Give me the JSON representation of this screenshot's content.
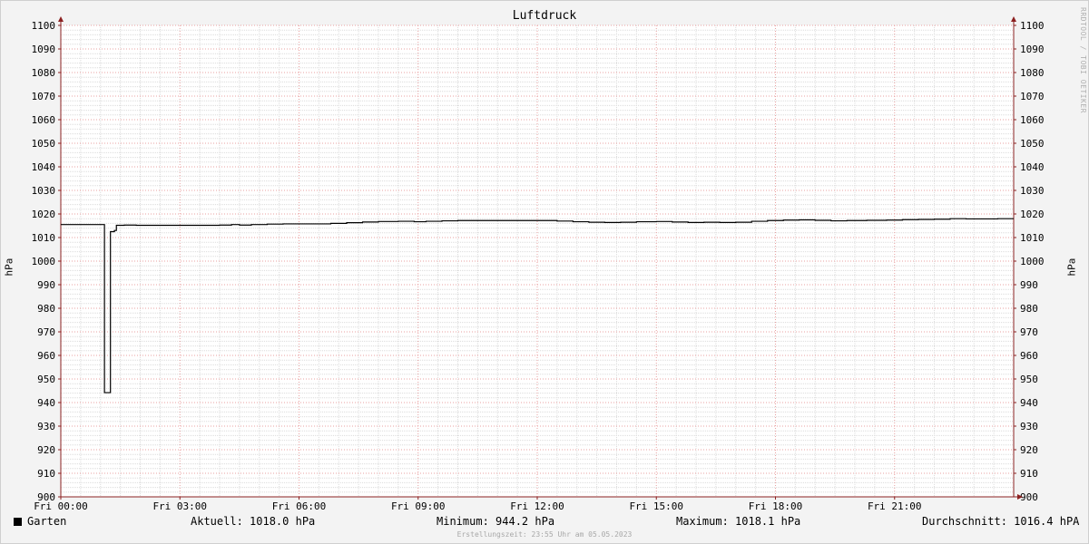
{
  "chart_data": {
    "type": "line",
    "title": "Luftdruck",
    "ylabel": "hPa",
    "ylim": [
      900,
      1100
    ],
    "yticks": [
      900,
      910,
      920,
      930,
      940,
      950,
      960,
      970,
      980,
      990,
      1000,
      1010,
      1020,
      1030,
      1040,
      1050,
      1060,
      1070,
      1080,
      1090,
      1100
    ],
    "xlim_hours": [
      0,
      24
    ],
    "xticks": [
      {
        "hour": 0,
        "label": "Fri 00:00"
      },
      {
        "hour": 3,
        "label": "Fri 03:00"
      },
      {
        "hour": 6,
        "label": "Fri 06:00"
      },
      {
        "hour": 9,
        "label": "Fri 09:00"
      },
      {
        "hour": 12,
        "label": "Fri 12:00"
      },
      {
        "hour": 15,
        "label": "Fri 15:00"
      },
      {
        "hour": 18,
        "label": "Fri 18:00"
      },
      {
        "hour": 21,
        "label": "Fri 21:00"
      }
    ],
    "grid": true,
    "series": [
      {
        "name": "Garten",
        "color": "#000000",
        "points": [
          [
            0.0,
            1015.5
          ],
          [
            1.05,
            1015.5
          ],
          [
            1.1,
            944.2
          ],
          [
            1.18,
            944.2
          ],
          [
            1.25,
            1012.5
          ],
          [
            1.35,
            1013.0
          ],
          [
            1.4,
            1015.2
          ],
          [
            1.6,
            1015.3
          ],
          [
            1.9,
            1015.2
          ],
          [
            2.2,
            1015.2
          ],
          [
            2.5,
            1015.2
          ],
          [
            3.0,
            1015.2
          ],
          [
            3.5,
            1015.2
          ],
          [
            4.0,
            1015.3
          ],
          [
            4.3,
            1015.5
          ],
          [
            4.5,
            1015.3
          ],
          [
            4.8,
            1015.5
          ],
          [
            5.2,
            1015.7
          ],
          [
            5.6,
            1015.8
          ],
          [
            6.0,
            1015.8
          ],
          [
            6.5,
            1015.8
          ],
          [
            6.8,
            1016.0
          ],
          [
            7.2,
            1016.3
          ],
          [
            7.6,
            1016.6
          ],
          [
            8.0,
            1016.8
          ],
          [
            8.5,
            1016.9
          ],
          [
            8.9,
            1016.7
          ],
          [
            9.2,
            1016.9
          ],
          [
            9.6,
            1017.1
          ],
          [
            10.0,
            1017.2
          ],
          [
            10.5,
            1017.2
          ],
          [
            11.0,
            1017.2
          ],
          [
            11.5,
            1017.2
          ],
          [
            12.0,
            1017.2
          ],
          [
            12.5,
            1017.0
          ],
          [
            12.9,
            1016.7
          ],
          [
            13.3,
            1016.5
          ],
          [
            13.7,
            1016.4
          ],
          [
            14.1,
            1016.5
          ],
          [
            14.5,
            1016.7
          ],
          [
            15.0,
            1016.8
          ],
          [
            15.4,
            1016.6
          ],
          [
            15.8,
            1016.4
          ],
          [
            16.2,
            1016.5
          ],
          [
            16.6,
            1016.4
          ],
          [
            17.0,
            1016.5
          ],
          [
            17.4,
            1016.9
          ],
          [
            17.8,
            1017.2
          ],
          [
            18.2,
            1017.4
          ],
          [
            18.6,
            1017.5
          ],
          [
            19.0,
            1017.3
          ],
          [
            19.4,
            1017.1
          ],
          [
            19.8,
            1017.2
          ],
          [
            20.3,
            1017.3
          ],
          [
            20.8,
            1017.4
          ],
          [
            21.2,
            1017.6
          ],
          [
            21.6,
            1017.7
          ],
          [
            22.0,
            1017.8
          ],
          [
            22.4,
            1018.0
          ],
          [
            22.8,
            1017.9
          ],
          [
            23.2,
            1017.9
          ],
          [
            23.6,
            1018.0
          ],
          [
            24.0,
            1018.0
          ]
        ]
      }
    ]
  },
  "watermark": "RRDTOOL / TOBI OETIKER",
  "legend": {
    "series_name": "Garten",
    "current": "Aktuell: 1018.0 hPa",
    "minimum": "Minimum: 944.2 hPa",
    "maximum": "Maximum: 1018.1 hPa",
    "average": "Durchschnitt: 1016.4 hPA"
  },
  "footer": "Erstellungszeit: 23:55 Uhr am 05.05.2023",
  "colors": {
    "background": "#f3f3f3",
    "plot": "#ffffff",
    "minor_grid": "#dcdcdc",
    "major_grid": "#e8a0a0",
    "axis": "#8b2020",
    "line": "#000000"
  }
}
